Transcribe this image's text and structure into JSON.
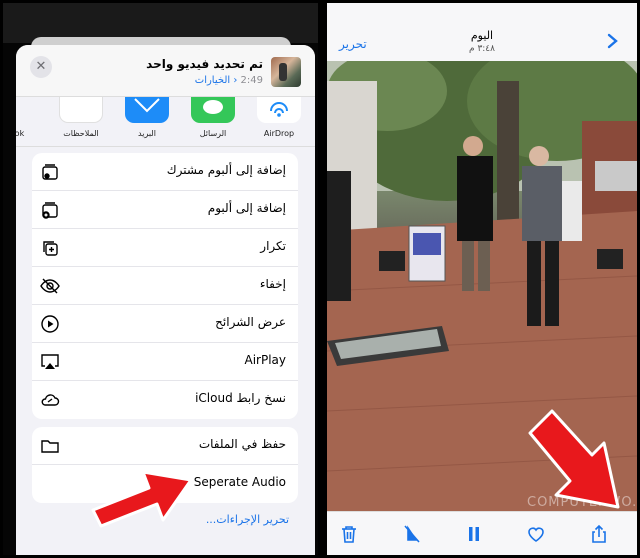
{
  "share_sheet": {
    "title": "تم تحديد فيديو واحد",
    "duration": "2:49",
    "options_link": "الخيارات",
    "close_icon": "close-icon",
    "apps": [
      {
        "label": "AirDrop",
        "icon": "airdrop-icon",
        "color": "#ffffff"
      },
      {
        "label": "الرسائل",
        "icon": "messages-icon",
        "color": "#34c759"
      },
      {
        "label": "البريد",
        "icon": "mail-icon",
        "color": "#1d8cf8"
      },
      {
        "label": "الملاحظات",
        "icon": "notes-icon",
        "color": "#ffffff"
      },
      {
        "label": "ook",
        "icon": "facebook-icon",
        "color": "#f2f2f7"
      }
    ],
    "group1": [
      {
        "label": "إضافة إلى ألبوم مشترك",
        "icon": "shared-album-icon"
      },
      {
        "label": "إضافة إلى ألبوم",
        "icon": "add-album-icon"
      },
      {
        "label": "تكرار",
        "icon": "duplicate-icon"
      },
      {
        "label": "إخفاء",
        "icon": "hide-eye-icon"
      },
      {
        "label": "عرض الشرائح",
        "icon": "slideshow-play-icon"
      },
      {
        "label": "AirPlay",
        "icon": "airplay-icon"
      },
      {
        "label": "نسخ رابط iCloud",
        "icon": "icloud-link-icon"
      }
    ],
    "group2": [
      {
        "label": "حفظ في الملفات",
        "icon": "folder-icon"
      },
      {
        "label": "Seperate Audio",
        "icon": ""
      }
    ],
    "edit_actions": "تحرير الإجراءات..."
  },
  "viewer": {
    "title": "اليوم",
    "time": "٣:٤٨ م",
    "edit_label": "تحرير",
    "watermark": "COMPUTERWO.COM",
    "accent": "#1a73e8",
    "toolbar": [
      "trash-icon",
      "mute-icon",
      "pause-icon",
      "heart-icon",
      "share-icon"
    ]
  },
  "annotation_color": "#e8181c"
}
